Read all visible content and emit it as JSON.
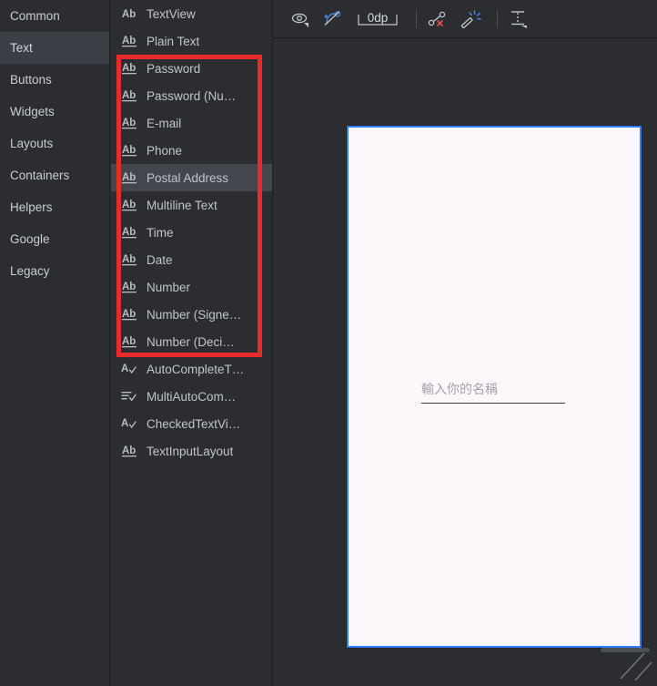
{
  "sidebar": {
    "items": [
      {
        "label": "Common",
        "selected": false
      },
      {
        "label": "Text",
        "selected": true
      },
      {
        "label": "Buttons",
        "selected": false
      },
      {
        "label": "Widgets",
        "selected": false
      },
      {
        "label": "Layouts",
        "selected": false
      },
      {
        "label": "Containers",
        "selected": false
      },
      {
        "label": "Helpers",
        "selected": false
      },
      {
        "label": "Google",
        "selected": false
      },
      {
        "label": "Legacy",
        "selected": false
      }
    ]
  },
  "palette": {
    "items": [
      {
        "label": "TextView",
        "icon": "ab-icon",
        "selected": false
      },
      {
        "label": "Plain Text",
        "icon": "ab-underline-icon",
        "selected": false
      },
      {
        "label": "Password",
        "icon": "ab-underline-icon",
        "selected": false
      },
      {
        "label": "Password (Nu…",
        "icon": "ab-underline-icon",
        "selected": false
      },
      {
        "label": "E-mail",
        "icon": "ab-underline-icon",
        "selected": false
      },
      {
        "label": "Phone",
        "icon": "ab-underline-icon",
        "selected": false
      },
      {
        "label": "Postal Address",
        "icon": "ab-underline-icon",
        "selected": true
      },
      {
        "label": "Multiline Text",
        "icon": "ab-underline-icon",
        "selected": false
      },
      {
        "label": "Time",
        "icon": "ab-underline-icon",
        "selected": false
      },
      {
        "label": "Date",
        "icon": "ab-underline-icon",
        "selected": false
      },
      {
        "label": "Number",
        "icon": "ab-underline-icon",
        "selected": false
      },
      {
        "label": "Number (Signe…",
        "icon": "ab-underline-icon",
        "selected": false
      },
      {
        "label": "Number (Deci…",
        "icon": "ab-underline-icon",
        "selected": false
      },
      {
        "label": "AutoCompleteT…",
        "icon": "a-check-icon",
        "selected": false
      },
      {
        "label": "MultiAutoCom…",
        "icon": "lines-check-icon",
        "selected": false
      },
      {
        "label": "CheckedTextVi…",
        "icon": "a-check-icon",
        "selected": false
      },
      {
        "label": "TextInputLayout",
        "icon": "ab-underline-icon",
        "selected": false
      }
    ],
    "highlight_color": "#e82c2c"
  },
  "toolbar": {
    "buttons": [
      {
        "name": "view-options",
        "icon": "eye-icon",
        "label": ""
      },
      {
        "name": "toggle-constraints",
        "icon": "constraints-off-icon",
        "label": ""
      },
      {
        "name": "default-margin",
        "icon": "margin-icon",
        "label": "0dp"
      },
      {
        "name": "clear-constraints",
        "icon": "clear-constraints-icon",
        "label": ""
      },
      {
        "name": "infer-constraints",
        "icon": "magic-wand-icon",
        "label": ""
      },
      {
        "name": "guidelines",
        "icon": "baseline-guideline-icon",
        "label": ""
      }
    ],
    "margin_value": "0dp"
  },
  "preview": {
    "edit_text_hint": "輸入你的名稱",
    "frame_border_color": "#2f7dfa",
    "frame_background": "#fdf6fb"
  }
}
